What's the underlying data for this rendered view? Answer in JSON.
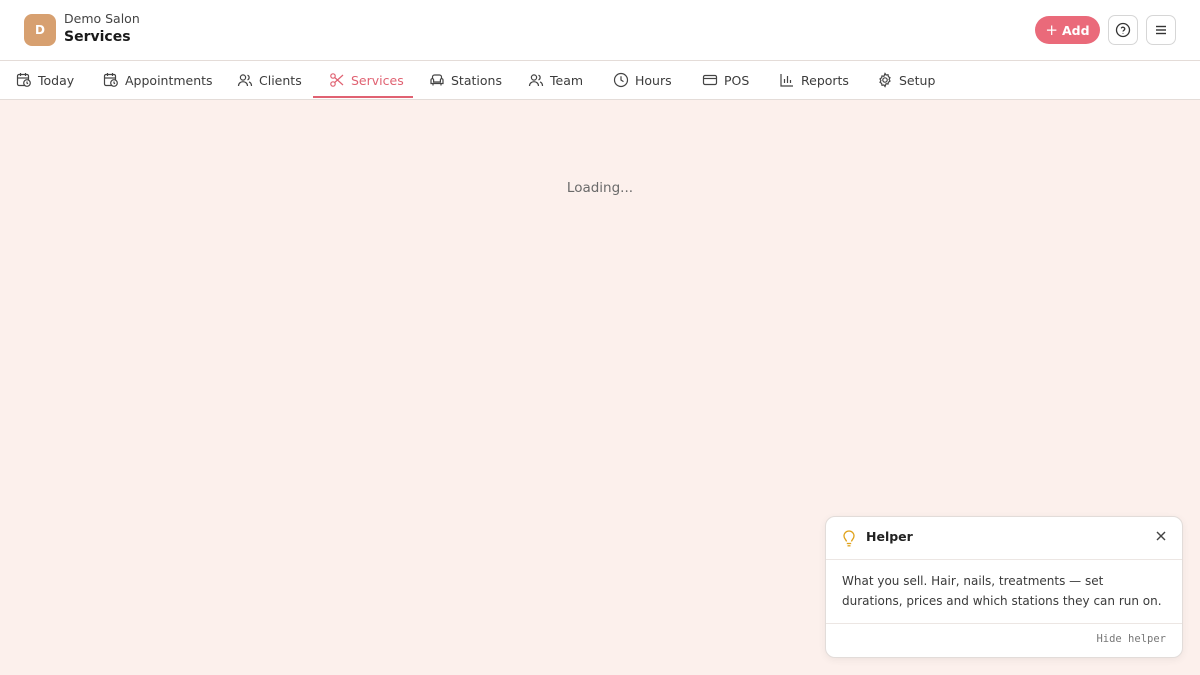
{
  "header": {
    "avatar_initial": "D",
    "salon_name": "Demo Salon",
    "page_title": "Services",
    "add_label": "Add",
    "help_icon": "help-circle-icon",
    "menu_icon": "hamburger-menu-icon"
  },
  "nav": {
    "active": "Services",
    "tabs": [
      {
        "label": "Today",
        "icon": "calendar-clock-icon"
      },
      {
        "label": "Appointments",
        "icon": "calendar-clock-icon"
      },
      {
        "label": "Clients",
        "icon": "users-icon"
      },
      {
        "label": "Services",
        "icon": "scissors-icon"
      },
      {
        "label": "Stations",
        "icon": "armchair-icon"
      },
      {
        "label": "Team",
        "icon": "users-icon"
      },
      {
        "label": "Hours",
        "icon": "clock-icon"
      },
      {
        "label": "POS",
        "icon": "credit-card-icon"
      },
      {
        "label": "Reports",
        "icon": "bar-chart-icon"
      },
      {
        "label": "Setup",
        "icon": "gear-icon"
      }
    ]
  },
  "main": {
    "loading_text": "Loading..."
  },
  "helper": {
    "title": "Helper",
    "body": "What you sell. Hair, nails, treatments — set durations, prices and which stations they can run on.",
    "hide_label": "Hide helper"
  },
  "colors": {
    "accent": "#e06272",
    "add_button": "#ea6a7a",
    "avatar": "#d7a070",
    "background": "#fcf0ec",
    "bulb": "#e0a21a"
  }
}
